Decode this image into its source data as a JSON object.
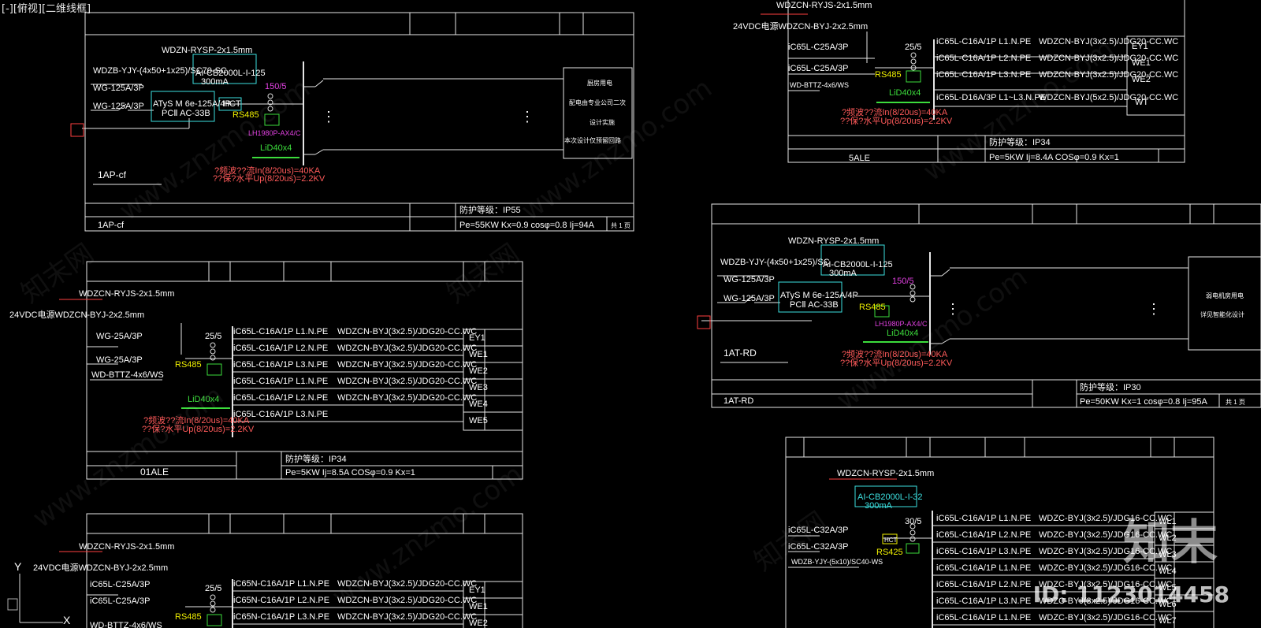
{
  "viewport": {
    "title": "[-][俯视][二维线框]"
  },
  "watermarks": {
    "cn": "知末网",
    "url": "www.znzmo.com",
    "logo": "知末",
    "id": "ID: 1123014458"
  },
  "panel_1ap": {
    "cable_top": "WDZN-RYSP-2x1.5mm",
    "cable_in": "WDZB-YJY-(4x50+1x25)/SC70-SC",
    "spd_model": "AI-CB2000L-I-125",
    "leak": "300mA",
    "ct": "150/5",
    "breaker1": "WG-125A/3P",
    "breaker2": "WG-125A/3P",
    "ats1": "ATyS M 6e-125A/4P",
    "ats2": "PCⅡ AC-33B",
    "hct": "HCT",
    "rs485": "RS485",
    "meter": "LH1980P-AX4/C",
    "lid": "LiD40x4",
    "spd1": "?频波??流In(8/20us)=40KA",
    "spd2": "??保?水平Up(8/20us)=2.2KV",
    "dest1": "厨房用电",
    "dest2": "配电由专业公司二次",
    "dest3": "设计实施",
    "dest4": "本次设计仅预留回路",
    "name": "1AP-cf",
    "ip": "防护等级：IP55",
    "load": "Pe=55KW  Kx=0.9  cosφ=0.8  Ij=94A",
    "sheet": "共 1 页"
  },
  "panel_5ale": {
    "cable_top": "WDZCN-RYJS-2x1.5mm",
    "cable_24v": "24VDC电源WDZCN-BYJ-2x2.5mm",
    "ct": "25/5",
    "b1": "iC65L-C25A/3P",
    "b2": "iC65L-C25A/3P",
    "rs485": "RS485",
    "lid": "LiD40x4",
    "bttz": "WD-BTTZ-4x6/WS",
    "spd1": "?频波??流In(8/20us)=40KA",
    "spd2": "??保?水平Up(8/20us)=2.2KV",
    "rows": [
      {
        "br": "iC65L-C16A/1P L1.N.PE",
        "cab": "WDZCN-BYJ(3x2.5)/JDG20-CC.WC",
        "id": "EY1"
      },
      {
        "br": "iC65L-C16A/1P L2.N.PE",
        "cab": "WDZCN-BYJ(3x2.5)/JDG20-CC.WC",
        "id": "WE1"
      },
      {
        "br": "iC65L-C16A/1P L3.N.PE",
        "cab": "WDZCN-BYJ(3x2.5)/JDG20-CC.WC",
        "id": "WE2"
      },
      {
        "br": "iC65L-D16A/3P L1~L3.N.PE",
        "cab": "WDZCN-BYJ(5x2.5)/JDG20-CC.WC",
        "id": "WT"
      }
    ],
    "name": "5ALE",
    "ip": "防护等级：IP34",
    "load": "Pe=5KW  Ij=8.4A  COSφ=0.9  Kx=1"
  },
  "panel_1atrd": {
    "cable_top": "WDZN-RYSP-2x1.5mm",
    "cable_in": "WDZB-YJY-(4x50+1x25)/SC",
    "spd_model": "AI-CB2000L-I-125",
    "leak": "300mA",
    "ct": "150/5",
    "breaker1": "WG-125A/3P",
    "breaker2": "WG-125A/3P",
    "ats1": "ATyS M 6e-125A/4P",
    "ats2": "PCⅡ AC-33B",
    "rs485": "RS485",
    "meter": "LH1980P-AX4/C",
    "lid": "LiD40x4",
    "spd1": "?频波??流In(8/20us)=40KA",
    "spd2": "??保?水平Up(8/20us)=2.2KV",
    "dest1": "弱电机房用电",
    "dest2": "详见智能化设计",
    "name": "1AT-RD",
    "ip": "防护等级：IP30",
    "load": "Pe=50KW  Kx=1  cosφ=0.8  Ij=95A",
    "sheet": "共 1 页"
  },
  "panel_01ale": {
    "cable_top": "WDZCN-RYJS-2x1.5mm",
    "cable_24v": "24VDC电源WDZCN-BYJ-2x2.5mm",
    "ct": "25/5",
    "b1": "WG-25A/3P",
    "b2": "WG-25A/3P",
    "rs485": "RS485",
    "lid": "LiD40x4",
    "bttz": "WD-BTTZ-4x6/WS",
    "spd1": "?频波??流In(8/20us)=40KA",
    "spd2": "??保?水平Up(8/20us)=2.2KV",
    "rows": [
      {
        "br": "iC65L-C16A/1P L1.N.PE",
        "cab": "WDZCN-BYJ(3x2.5)/JDG20-CC.WC",
        "id": "EY1"
      },
      {
        "br": "iC65L-C16A/1P L2.N.PE",
        "cab": "WDZCN-BYJ(3x2.5)/JDG20-CC.WC",
        "id": "WE1"
      },
      {
        "br": "iC65L-C16A/1P L3.N.PE",
        "cab": "WDZCN-BYJ(3x2.5)/JDG20-CC.WC",
        "id": "WE2"
      },
      {
        "br": "iC65L-C16A/1P L1.N.PE",
        "cab": "WDZCN-BYJ(3x2.5)/JDG20-CC.WC",
        "id": "WE3"
      },
      {
        "br": "iC65L-C16A/1P L2.N.PE",
        "cab": "WDZCN-BYJ(3x2.5)/JDG20-CC.WC",
        "id": "WE4"
      },
      {
        "br": "iC65L-C16A/1P L3.N.PE",
        "cab": "",
        "id": "WE5"
      }
    ],
    "name": "01ALE",
    "ip": "防护等级：IP34",
    "load": "Pe=5KW  Ij=8.5A  COSφ=0.9  Kx=1"
  },
  "panel_bottom_left": {
    "cable_top": "WDZCN-RYJS-2x1.5mm",
    "cable_24v": "24VDC电源WDZCN-BYJ-2x2.5mm",
    "ct": "25/5",
    "b1": "iC65L-C25A/3P",
    "b2": "iC65L-C25A/3P",
    "rs485": "RS485",
    "bttz": "WD-BTTZ-4x6/WS",
    "rows": [
      {
        "br": "iC65N-C16A/1P L1.N.PE",
        "cab": "WDZCN-BYJ(3x2.5)/JDG20-CC.WC",
        "id": "EY1"
      },
      {
        "br": "iC65N-C16A/1P L2.N.PE",
        "cab": "WDZCN-BYJ(3x2.5)/JDG20-CC.WC",
        "id": "WE1"
      },
      {
        "br": "iC65N-C16A/1P L3.N.PE",
        "cab": "WDZCN-BYJ(3x2.5)/JDG20-CC.WC",
        "id": "WE2"
      }
    ]
  },
  "panel_wl": {
    "cable_top": "WDZCN-RYSP-2x1.5mm",
    "spd_model": "AI-CB2000L-I-32",
    "leak": "300mA",
    "ct": "30/5",
    "b1": "iC65L-C32A/3P",
    "b2": "iC65L-C32A/3P",
    "hct": "HCT",
    "rs485": "RS425",
    "cable_in": "WDZB-YJY-(5x10)/SC40-WS",
    "rows": [
      {
        "br": "iC65L-C16A/1P L1.N.PE",
        "cab": "WDZC-BYJ(3x2.5)/JDG16-CC.WC",
        "id": "WL1"
      },
      {
        "br": "iC65L-C16A/1P L2.N.PE",
        "cab": "WDZC-BYJ(3x2.5)/JDG16-CC.WC",
        "id": "WL2"
      },
      {
        "br": "iC65L-C16A/1P L3.N.PE",
        "cab": "WDZC-BYJ(3x2.5)/JDG16-CC.WC",
        "id": "WL3"
      },
      {
        "br": "iC65L-C16A/1P L1.N.PE",
        "cab": "WDZC-BYJ(3x2.5)/JDG16-CC.WC",
        "id": "WL4"
      },
      {
        "br": "iC65L-C16A/1P L2.N.PE",
        "cab": "WDZC-BYJ(3x2.5)/JDG16-CC.WC",
        "id": "WL5"
      },
      {
        "br": "iC65L-C16A/1P L3.N.PE",
        "cab": "WDZC-BYJ(3x2.5)/JDG16-CC.WC",
        "id": "WL6"
      },
      {
        "br": "iC65L-C16A/1P L1.N.PE",
        "cab": "WDZC-BYJ(3x2.5)/JDG16-CC.WC",
        "id": "WL7"
      }
    ]
  },
  "ucs": {
    "y": "Y",
    "x": "X"
  }
}
